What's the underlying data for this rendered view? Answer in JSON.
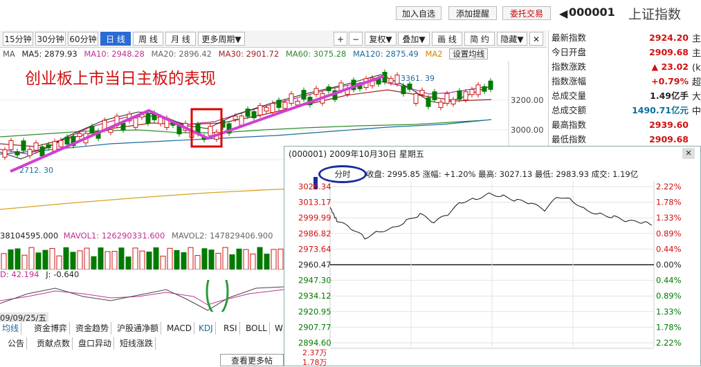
{
  "topbar": {
    "btn_add": "加入自选",
    "btn_alert": "添加提醒",
    "btn_trade": "委托交易",
    "code": "000001",
    "name": "上证指数"
  },
  "toolbar": {
    "items": [
      "15分钟",
      "30分钟",
      "60分钟",
      "日 线",
      "周 线",
      "月 线",
      "更多周期▼"
    ],
    "right": [
      "+",
      "−",
      "复权▼",
      "叠加▼",
      "画 线",
      "简 约",
      "隐藏▼"
    ],
    "close": "✕"
  },
  "indicators": {
    "ma": "MA",
    "ma5": "MA5: 2879.93",
    "ma10": "MA10: 2948.28",
    "ma20": "MA20: 2896.42",
    "ma30": "MA30: 2901.72",
    "ma60": "MA60: 3075.28",
    "ma120": "MA120: 2875.49",
    "ma2": "MA2",
    "settings": "设置均线"
  },
  "chart": {
    "annotation": "创业板上市当日主板的表现",
    "low_label": "2712. 30",
    "high_label": "3361. 39",
    "price_3200": "3200.00",
    "price_3000": "3000.00"
  },
  "rpanel": {
    "rows": [
      {
        "label": "最新指数",
        "value": "2924.20",
        "cls": "red"
      },
      {
        "label": "今日开盘",
        "value": "2909.68",
        "cls": "red"
      },
      {
        "label": "指数涨跌",
        "value": "▲ 23.02",
        "cls": "red"
      },
      {
        "label": "指数涨幅",
        "value": "+0.79%",
        "cls": "red"
      },
      {
        "label": "总成交量",
        "value": "1.49亿手",
        "cls": ""
      },
      {
        "label": "总成交额",
        "value": "1490.71亿元",
        "cls": "teal"
      },
      {
        "label": "最高指数",
        "value": "2939.60",
        "cls": "red"
      },
      {
        "label": "最低指数",
        "value": "2909.68",
        "cls": "red"
      }
    ],
    "side": [
      "主",
      "主",
      "(k",
      "超",
      "大",
      "中"
    ]
  },
  "vol": {
    "v1": "38104595.000",
    "mavol1": "MAVOL1: 126290331.600",
    "mavol2": "MAVOL2: 147829406.900"
  },
  "kdj": {
    "d": "D: 42.194",
    "j": "J: -0.640"
  },
  "bottom": {
    "date": "09/09/25/五",
    "tabs": [
      "均线",
      "资金博弈",
      "资金趋势",
      "沪股通净额",
      "MACD",
      "KDJ",
      "RSI",
      "BOLL",
      "W"
    ],
    "tabs2": [
      "公告",
      "贡献点数",
      "盘口异动",
      "短线涨跌"
    ],
    "more": "查看更多帖"
  },
  "popup": {
    "title": "(000001) 2009年10月30日 星期五",
    "close": "✕",
    "tab": "分时",
    "info": "收盘: 2995.85  涨幅: +1.20%  最高: 3027.13  最低: 2983.93  成交: 1.19亿",
    "left_labels": [
      "3026.34",
      "3013.17",
      "2999.99",
      "2986.82",
      "2973.64",
      "2960.47",
      "2947.30",
      "2934.12",
      "2920.95",
      "2907.77",
      "2894.60"
    ],
    "right_labels": [
      "2.22%",
      "1.78%",
      "1.33%",
      "0.89%",
      "0.44%",
      "0.00%",
      "0.44%",
      "0.89%",
      "1.33%",
      "1.78%",
      "2.22%"
    ],
    "vol_labels": [
      "2.37万",
      "1.78万"
    ]
  },
  "colors": {
    "up": "#d01010",
    "down": "#007a00",
    "accent": "#2a6ad3",
    "magenta": "#d040d0"
  }
}
